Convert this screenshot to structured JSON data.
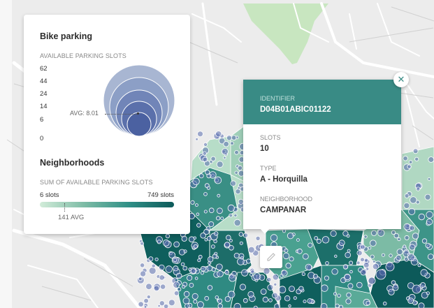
{
  "legend": {
    "bike_title": "Bike parking",
    "bike_subtitle": "AVAILABLE PARKING SLOTS",
    "bubble_ticks": [
      "62",
      "44",
      "24",
      "14",
      "6",
      "0"
    ],
    "bubble_avg": "AVG: 8.01",
    "hood_title": "Neighborhoods",
    "hood_subtitle": "SUM OF AVAILABLE PARKING SLOTS",
    "range_min": "6 slots",
    "range_max": "749 slots",
    "range_avg": "141 AVG",
    "bubble_color": "#3f5b9e",
    "ramp_colors": [
      "#d2ecd9",
      "#7cbba5",
      "#2f8f86",
      "#0d5a5a"
    ]
  },
  "popup": {
    "identifier_label": "IDENTIFIER",
    "identifier_value": "D04B01ABIC01122",
    "slots_label": "SLOTS",
    "slots_value": "10",
    "type_label": "TYPE",
    "type_value": "A - Horquilla",
    "neighborhood_label": "NEIGHBORHOOD",
    "neighborhood_value": "CAMPANAR",
    "header_color": "#398b85"
  },
  "controls": {
    "close_icon": "close-icon",
    "edit_icon": "pencil-icon"
  }
}
